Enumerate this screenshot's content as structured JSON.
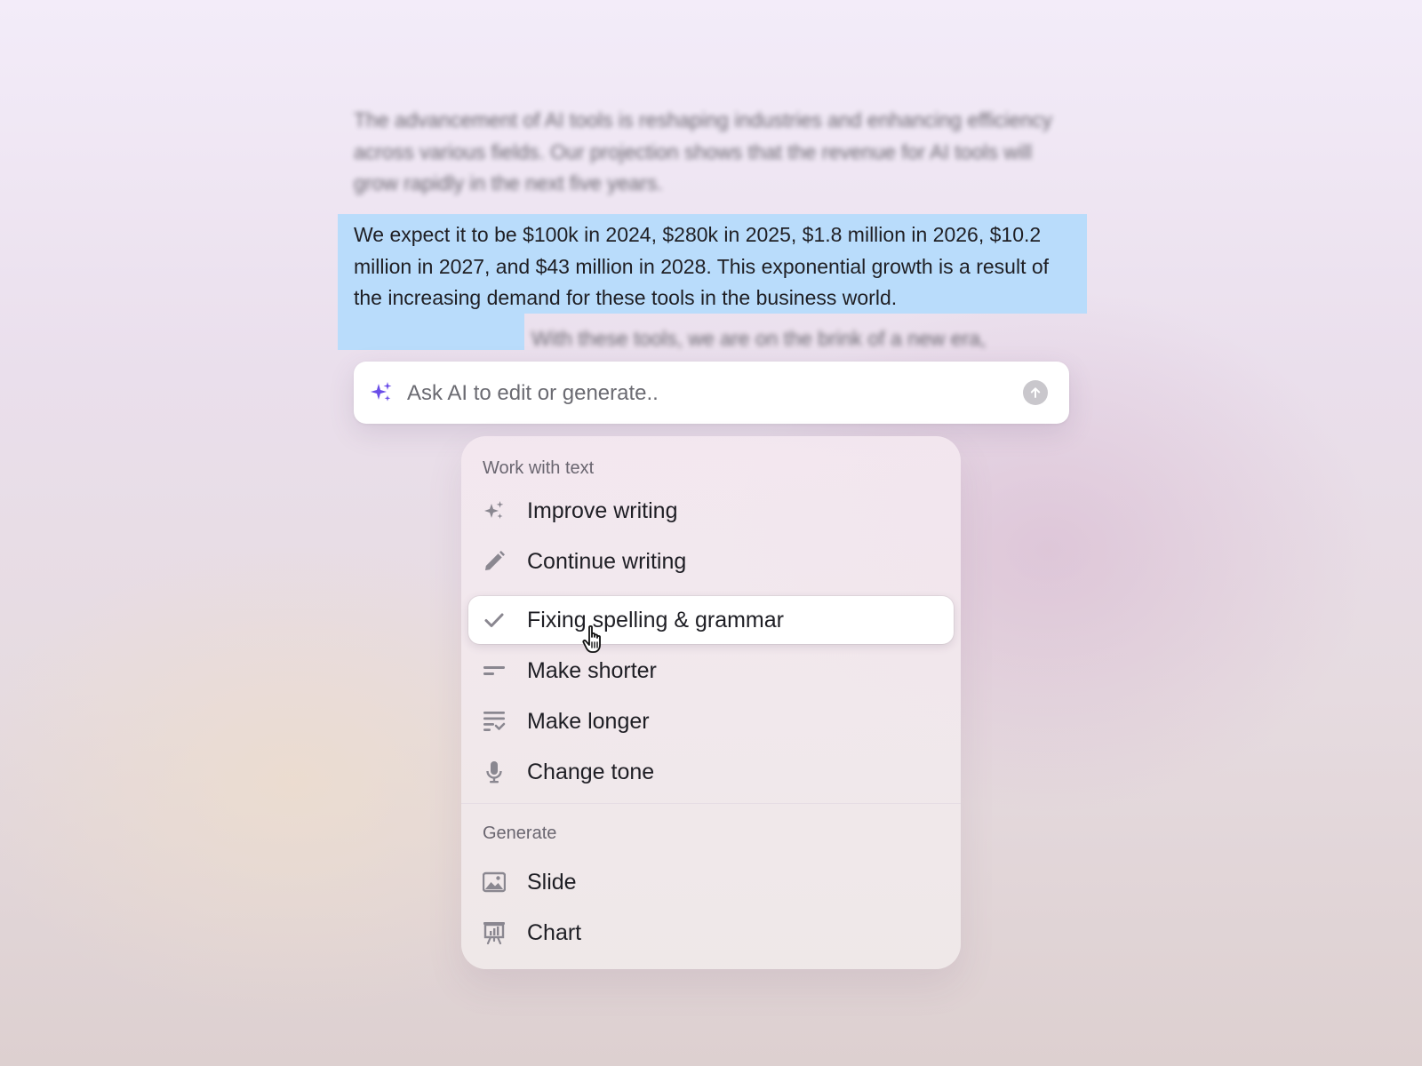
{
  "document": {
    "paragraph_1": "The advancement of AI tools is reshaping industries and enhancing efficiency across various fields. Our projection shows that the revenue for AI tools will grow rapidly in the next five years.",
    "selected_text": "We expect it to be $100k in 2024, $280k in 2025, $1.8 million in 2026, $10.2 million in 2027, and $43 million in 2028. This exponential growth is a result of the increasing demand for these tools in the business world.",
    "trailing_text": "With these tools, we are on the brink of a new era,"
  },
  "ask_bar": {
    "placeholder": "Ask AI to edit or generate..",
    "accent_color": "#6a4de8"
  },
  "menu": {
    "sections": [
      {
        "title": "Work with text",
        "items": [
          {
            "label": "Improve writing",
            "icon": "sparkles-icon"
          },
          {
            "label": "Continue writing",
            "icon": "pencil-icon"
          },
          {
            "label": "Fixing spelling & grammar",
            "icon": "check-icon",
            "active": true
          },
          {
            "label": "Make shorter",
            "icon": "short-lines-icon"
          },
          {
            "label": "Make longer",
            "icon": "long-lines-icon"
          },
          {
            "label": "Change tone",
            "icon": "microphone-icon"
          }
        ]
      },
      {
        "title": "Generate",
        "items": [
          {
            "label": "Slide",
            "icon": "image-icon"
          },
          {
            "label": "Chart",
            "icon": "chart-icon"
          }
        ]
      }
    ]
  },
  "colors": {
    "selection": "#b9dcfb",
    "icon_gray": "#8a8790",
    "text": "#1e1e24"
  }
}
